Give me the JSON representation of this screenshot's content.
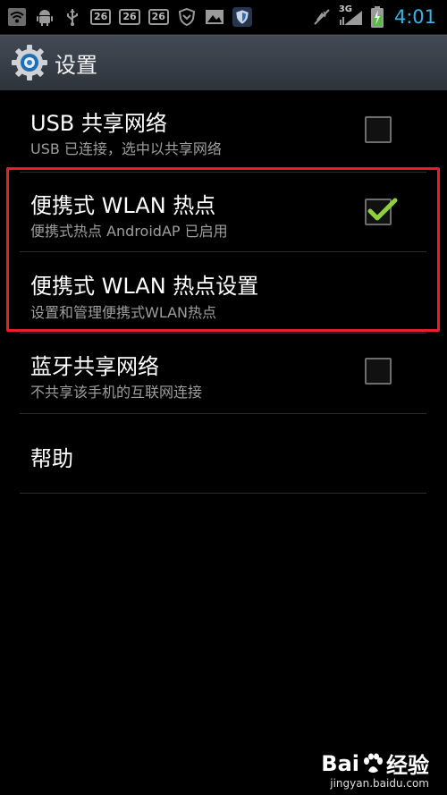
{
  "status_bar": {
    "icons_left": [
      "wifi-icon",
      "android-debug-icon",
      "usb-icon",
      "notification-26-a",
      "notification-26-b",
      "notification-26-c",
      "shield-outline-icon",
      "image-icon",
      "security-shield-icon"
    ],
    "badges": [
      "26",
      "26",
      "26"
    ],
    "network_label": "3G",
    "time": "4:01"
  },
  "action_bar": {
    "icon": "settings-gear-icon",
    "title": "设置"
  },
  "items": [
    {
      "title": "USB 共享网络",
      "subtitle": "USB 已连接，选中以共享网络",
      "checked": false
    },
    {
      "title": "便携式 WLAN 热点",
      "subtitle": "便携式热点 AndroidAP 已启用",
      "checked": true
    },
    {
      "title": "便携式 WLAN 热点设置",
      "subtitle": "设置和管理便携式WLAN热点"
    },
    {
      "title": "蓝牙共享网络",
      "subtitle": "不共享该手机的互联网连接",
      "checked": false
    },
    {
      "title": "帮助"
    }
  ],
  "watermark": {
    "brand_left": "Bai",
    "brand_right": "经验",
    "site": "jingyan.baidu.com"
  },
  "colors": {
    "accent": "#33b5e5",
    "checkmark": "#8ed13b",
    "highlight_box": "#e81f2a"
  }
}
